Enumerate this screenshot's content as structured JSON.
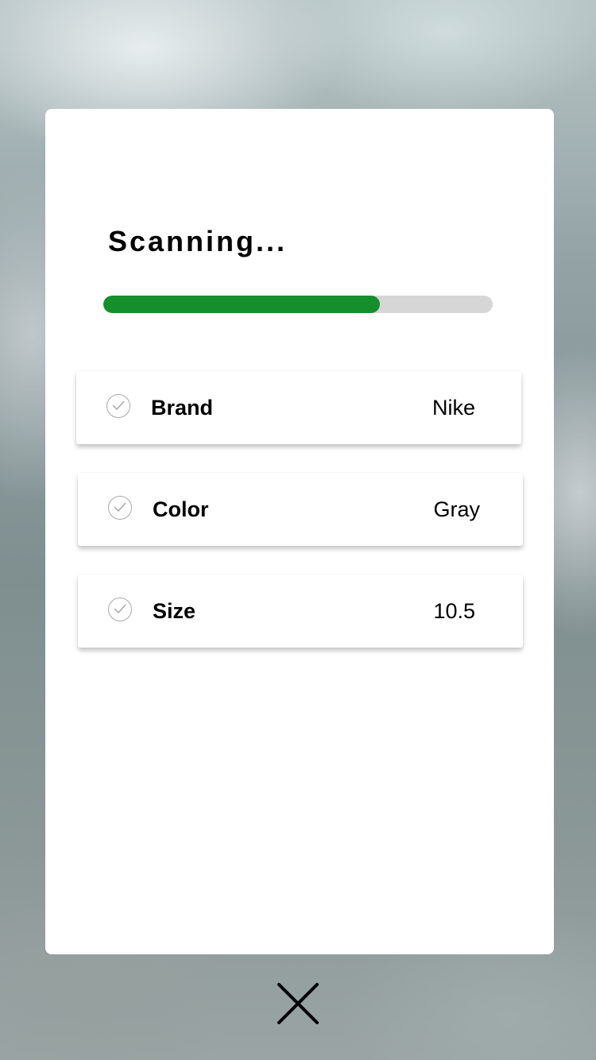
{
  "scan": {
    "title": "Scanning...",
    "progress_fraction": 0.71,
    "progress_color": "#158e2c",
    "track_color": "#d6d6d6"
  },
  "attributes": [
    {
      "label": "Brand",
      "value": "Nike",
      "status_icon": "check-circle-icon"
    },
    {
      "label": "Color",
      "value": "Gray",
      "status_icon": "check-circle-icon"
    },
    {
      "label": "Size",
      "value": "10.5",
      "status_icon": "check-circle-icon"
    }
  ],
  "close_icon": "close-icon"
}
